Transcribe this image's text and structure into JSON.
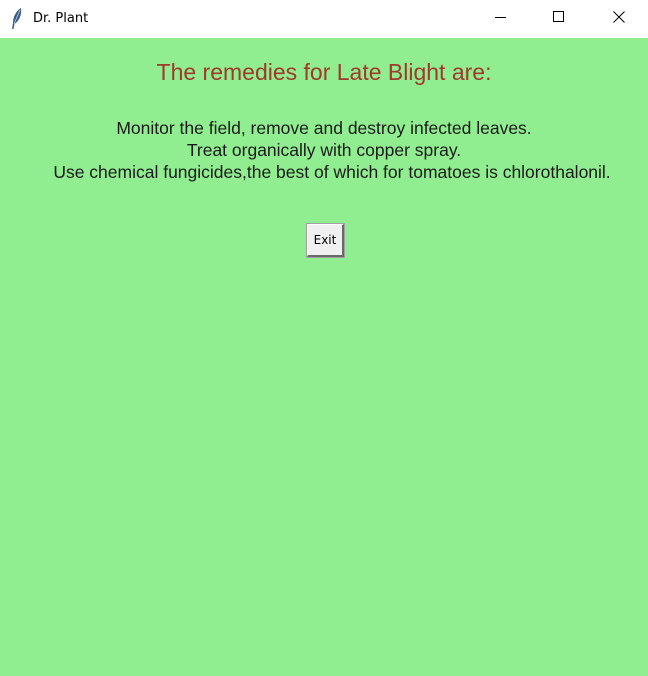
{
  "window": {
    "title": "Dr. Plant",
    "icon": "feather-icon",
    "controls": {
      "minimize_icon": "minimize-icon",
      "maximize_icon": "maximize-icon",
      "close_icon": "close-icon"
    }
  },
  "content": {
    "heading": "The remedies for Late Blight are:",
    "remedy_lines": [
      "Monitor the field, remove and destroy infected leaves.",
      "Treat organically with copper spray.",
      "Use chemical fungicides,the best of which for tomatoes is chlorothalonil."
    ],
    "exit_label": "Exit"
  },
  "colors": {
    "background": "#90ee90",
    "heading": "#a0392b",
    "text": "#1a1a1a"
  }
}
